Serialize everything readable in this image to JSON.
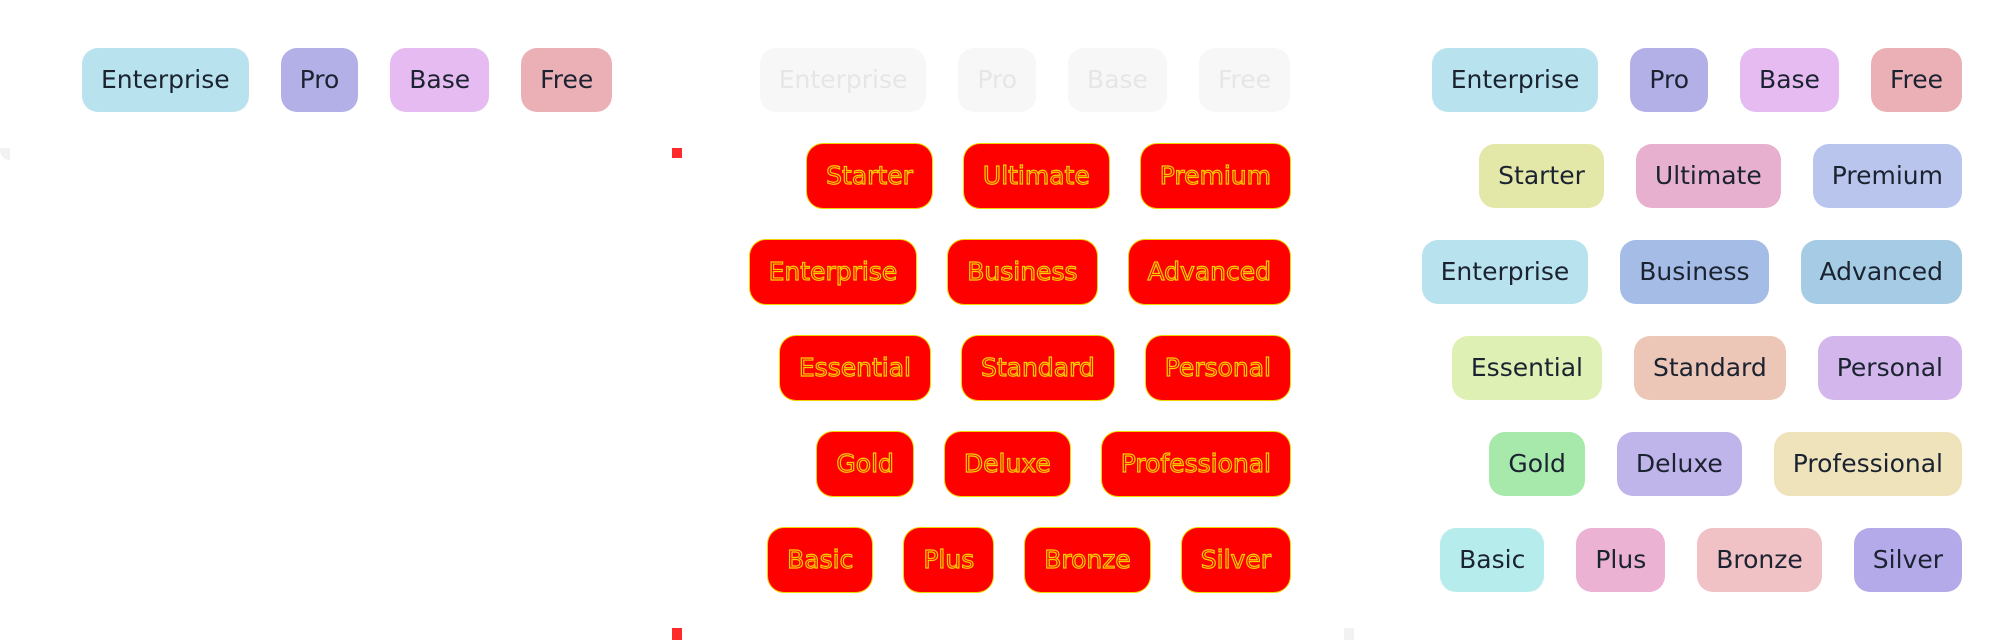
{
  "colors": {
    "cyan": "#b8e3ee",
    "indigo": "#b3b0e8",
    "lilac": "#e6bbf1",
    "rose": "#ebb0b5",
    "olive": "#e3e7a8",
    "pink": "#e7b0ce",
    "periwinkle": "#bac5ee",
    "steel": "#a4bce6",
    "sky": "#a5cce4",
    "lime": "#def0b4",
    "peach": "#ecc6b6",
    "violet": "#d2b6ec",
    "green": "#a7e8ab",
    "lavender": "#c0b5ea",
    "sand": "#efe3bc",
    "aqua": "#b7ecec",
    "orchid": "#ebb2d3",
    "blush": "#f0c1c5",
    "purple": "#b4aaea",
    "red_debug": "#ff0000",
    "yellow_outline": "#f5d000"
  },
  "left_panel": {
    "rows": [
      [
        "Enterprise",
        "Pro",
        "Base",
        "Free"
      ]
    ],
    "colors": [
      [
        "cyan",
        "indigo",
        "lilac",
        "rose"
      ]
    ]
  },
  "middle_panel": {
    "ghost_row": [
      "Enterprise",
      "Pro",
      "Base",
      "Free"
    ],
    "rows": [
      [
        "Starter",
        "Ultimate",
        "Premium"
      ],
      [
        "Enterprise",
        "Business",
        "Advanced"
      ],
      [
        "Essential",
        "Standard",
        "Personal"
      ],
      [
        "Gold",
        "Deluxe",
        "Professional"
      ],
      [
        "Basic",
        "Plus",
        "Bronze",
        "Silver"
      ]
    ]
  },
  "right_panel": {
    "rows": [
      [
        "Enterprise",
        "Pro",
        "Base",
        "Free"
      ],
      [
        "Starter",
        "Ultimate",
        "Premium"
      ],
      [
        "Enterprise",
        "Business",
        "Advanced"
      ],
      [
        "Essential",
        "Standard",
        "Personal"
      ],
      [
        "Gold",
        "Deluxe",
        "Professional"
      ],
      [
        "Basic",
        "Plus",
        "Bronze",
        "Silver"
      ]
    ],
    "colors": [
      [
        "cyan",
        "indigo",
        "lilac",
        "rose"
      ],
      [
        "olive",
        "pink",
        "periwinkle"
      ],
      [
        "cyan",
        "steel",
        "sky"
      ],
      [
        "lime",
        "peach",
        "violet"
      ],
      [
        "green",
        "lavender",
        "sand"
      ],
      [
        "aqua",
        "orchid",
        "blush",
        "purple"
      ]
    ]
  }
}
